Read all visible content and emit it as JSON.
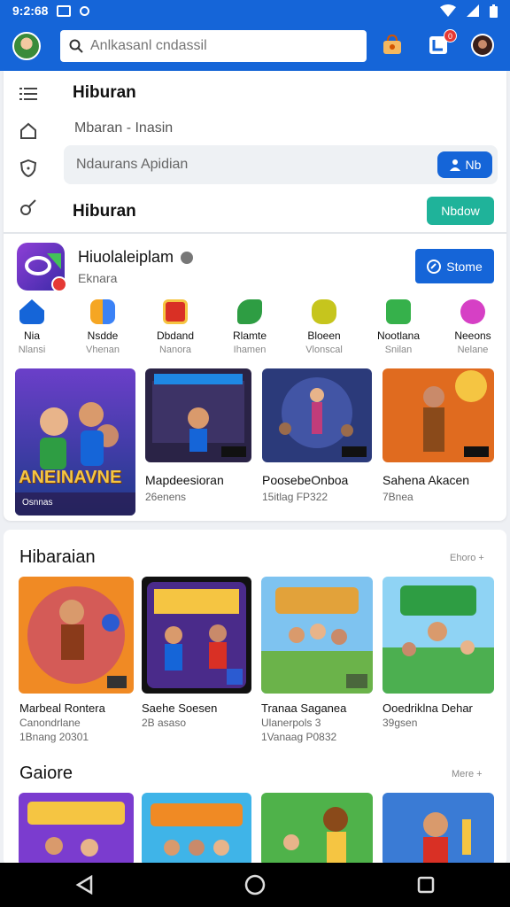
{
  "status_bar": {
    "time": "9:2:68"
  },
  "search": {
    "placeholder": "Anlkasanl cndassil"
  },
  "notifications": {
    "count": "0"
  },
  "top": {
    "title": "Hiburan",
    "subtitle": "Mbaran - Inasin",
    "field_text": "Ndaurans Apidian",
    "field_button": "Nb",
    "section2_title": "Hiburan",
    "teal_button": "Nbdow"
  },
  "app": {
    "name": "Hiuolaleiplam",
    "sub": "Eknara",
    "store_button": "Stome"
  },
  "categories": [
    {
      "label": "Nia",
      "sub": "Nlansi",
      "icon": "home-icon",
      "color": "#1565d8"
    },
    {
      "label": "Nsdde",
      "sub": "Vhenan",
      "icon": "puzzle-icon",
      "color": "#f5a623"
    },
    {
      "label": "Dbdand",
      "sub": "Nanora",
      "icon": "gift-icon",
      "color": "#d93025"
    },
    {
      "label": "Rlamte",
      "sub": "Ihamen",
      "icon": "leaf-icon",
      "color": "#2e9d43"
    },
    {
      "label": "Bloeen",
      "sub": "Vlonscal",
      "icon": "trophy-icon",
      "color": "#c6c51d"
    },
    {
      "label": "Nootlana",
      "sub": "Snilan",
      "icon": "chat-icon",
      "color": "#36b14b"
    },
    {
      "label": "Neeons",
      "sub": "Nelane",
      "icon": "smile-icon",
      "color": "#d640c5"
    }
  ],
  "featured": [
    {
      "overlay": "ANEINAVNE",
      "caption": "Osnnas"
    },
    {
      "title": "Mapdeesioran",
      "sub": "26enens"
    },
    {
      "title": "PoosebeOnboa",
      "sub": "15itlag FP322"
    },
    {
      "title": "Sahena Akacen",
      "sub": "7Bnea"
    }
  ],
  "section1": {
    "title": "Hibaraian",
    "more": "Ehoro +",
    "tiles": [
      {
        "title": "Marbeal Rontera",
        "sub": "Canondrlane\n1Bnang 20301"
      },
      {
        "title": "Saehe Soesen",
        "sub": "2B asaso"
      },
      {
        "title": "Tranaa Saganea",
        "sub": "Ulanerpols 3\n1Vanaag P0832"
      },
      {
        "title": "Ooedriklna Dehar",
        "sub": "39gsen"
      }
    ]
  },
  "section2": {
    "title": "Gaiore",
    "more": "Mere +"
  },
  "colors": {
    "primary": "#1565d8",
    "teal": "#1fb39a",
    "badge": "#e53935"
  }
}
